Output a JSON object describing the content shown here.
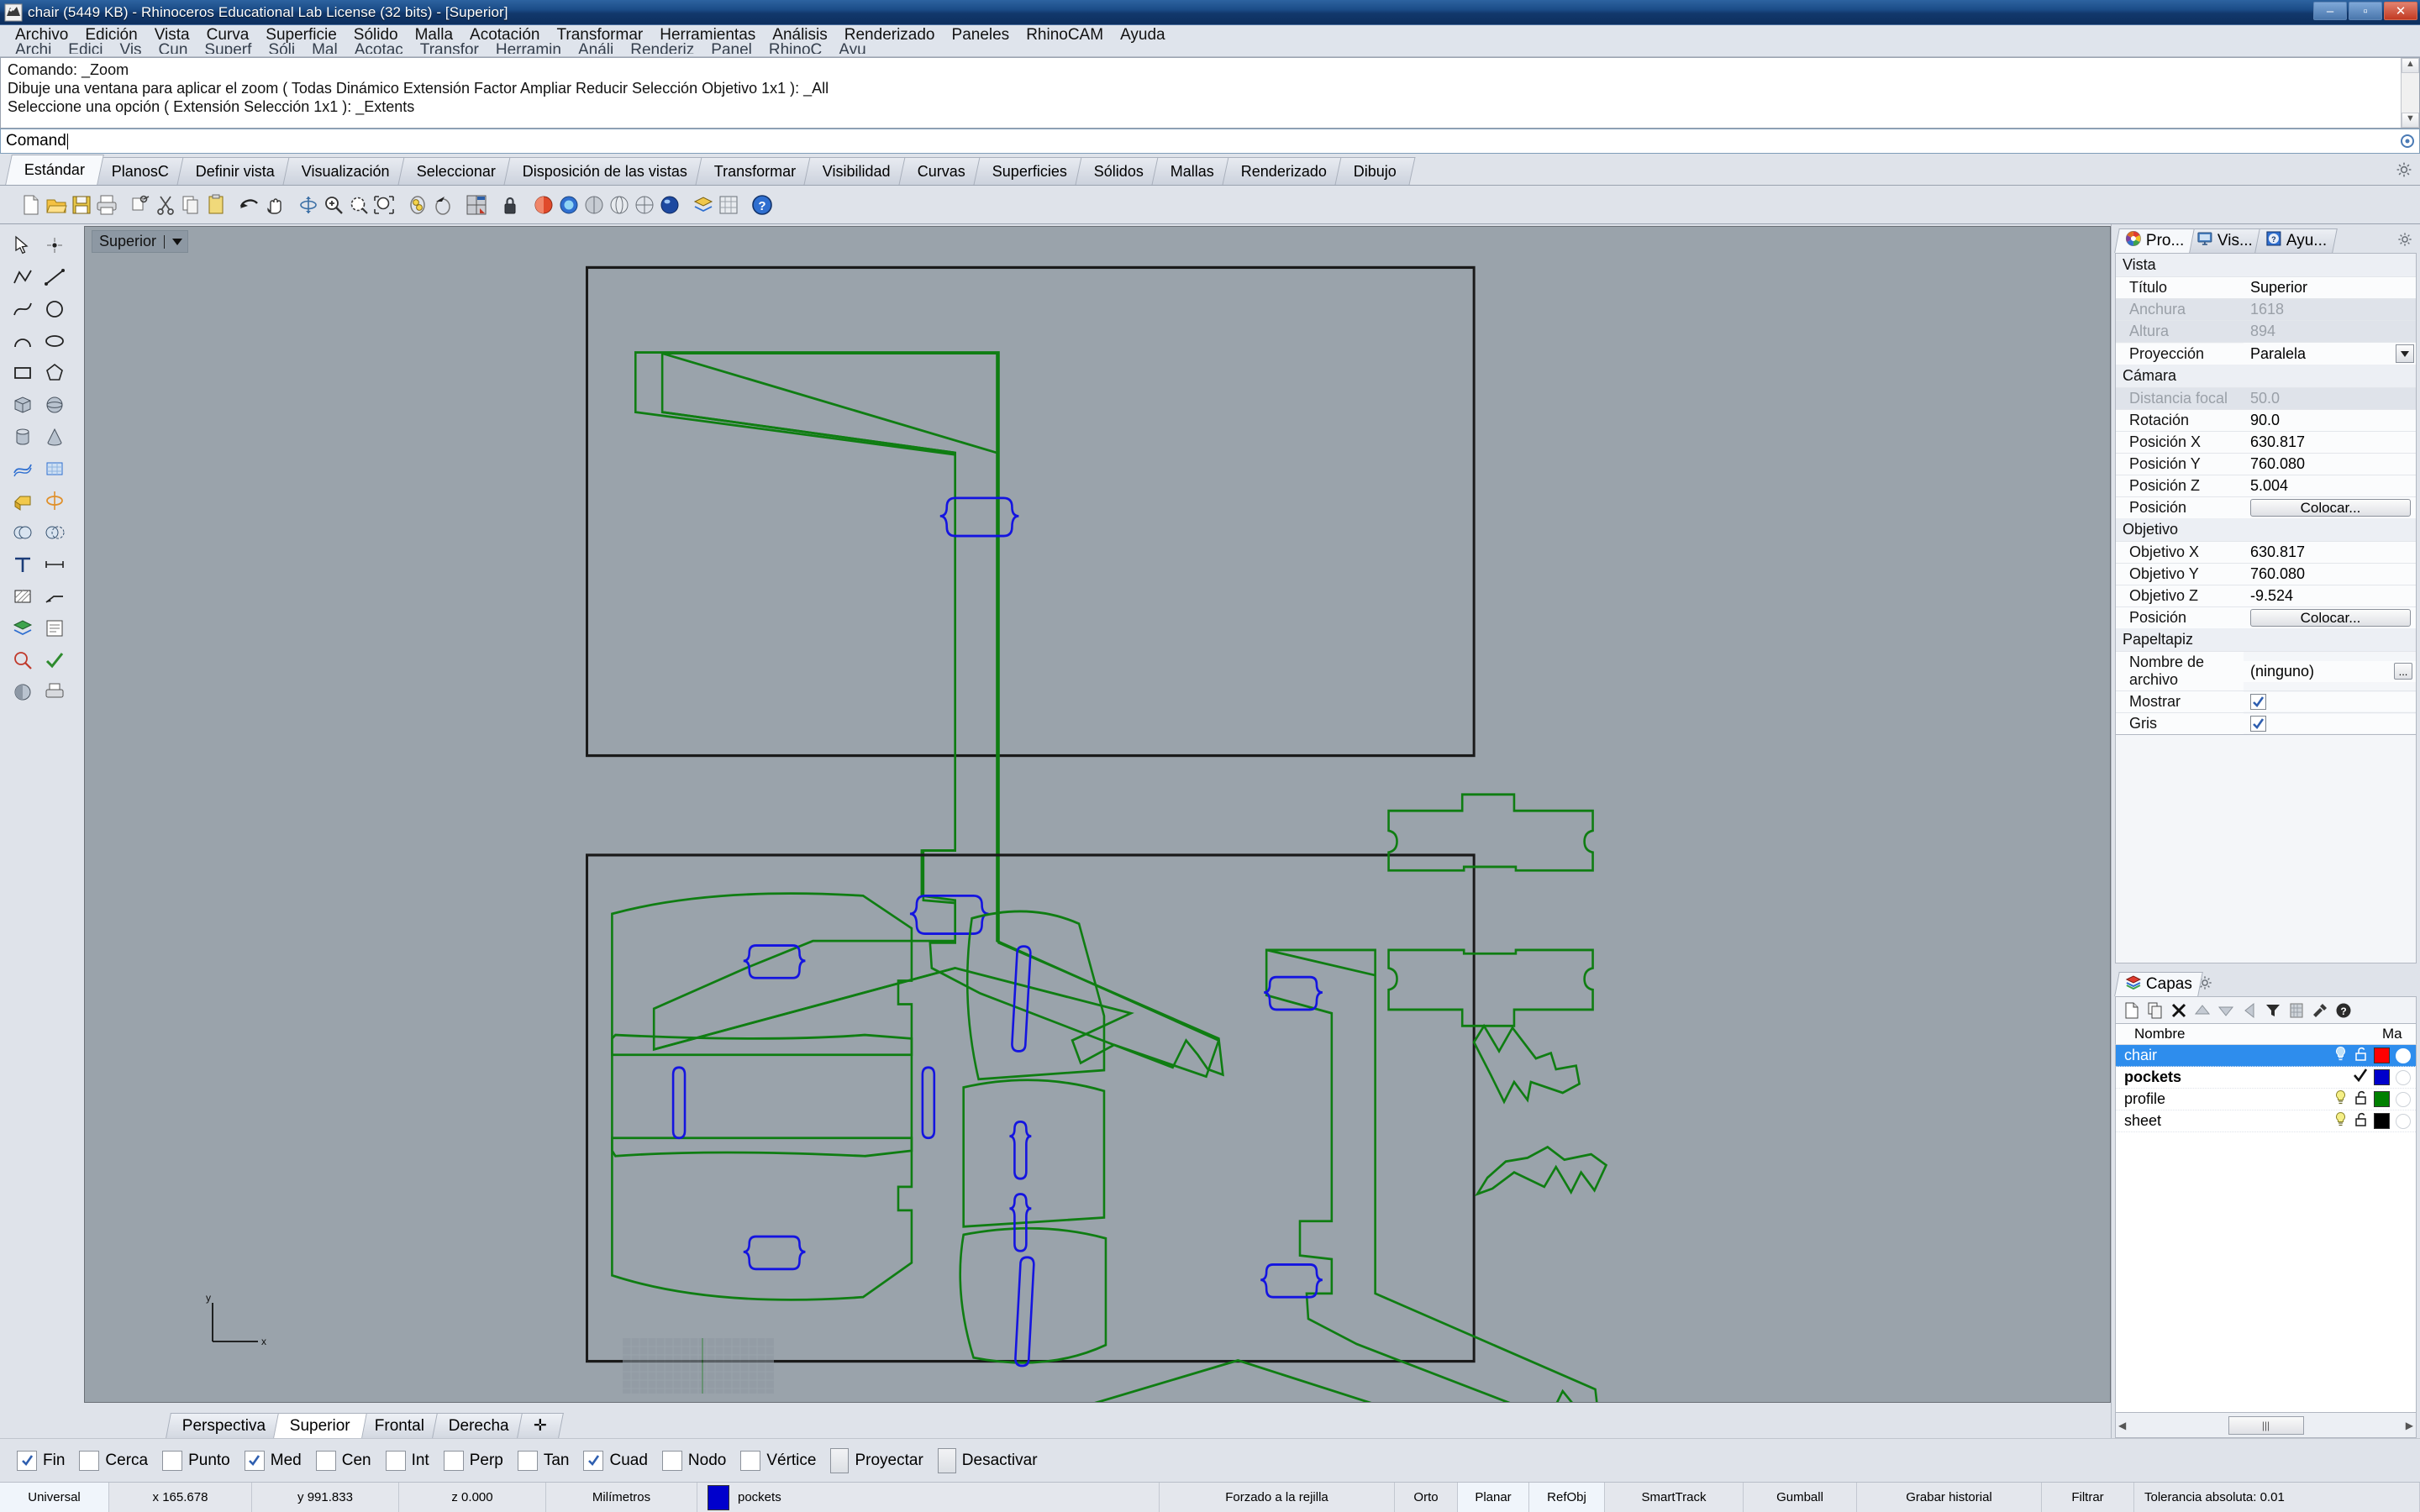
{
  "window": {
    "title": "chair (5449 KB) - Rhinoceros Educational Lab License (32 bits) - [Superior]",
    "minimize": "–",
    "maximize": "▫",
    "close": "✕"
  },
  "menubar": {
    "items": [
      "Archivo",
      "Edición",
      "Vista",
      "Curva",
      "Superficie",
      "Sólido",
      "Malla",
      "Acotación",
      "Transformar",
      "Herramientas",
      "Análisis",
      "Renderizado",
      "Paneles",
      "RhinoCAM",
      "Ayuda"
    ],
    "ghost_items": [
      "Archi",
      "Edici",
      "Vis",
      "Cun",
      "Superf",
      "Sóli",
      "Mal",
      "Acotac",
      "Transfor",
      "Herramin",
      "Análi",
      "Renderiz",
      "Panel",
      "RhinoC",
      "Ayu"
    ]
  },
  "command": {
    "history": [
      "Comando: _Zoom",
      "Dibuje una ventana para aplicar el zoom ( Todas  Dinámico  Extensión  Factor  Ampliar  Reducir  Selección  Objetivo  1x1 ): _All",
      "Seleccione una opción ( Extensión  Selección  1x1 ): _Extents"
    ],
    "prompt": "Comand"
  },
  "toolbar_tabs": {
    "items": [
      "Estándar",
      "PlanosC",
      "Definir vista",
      "Visualización",
      "Seleccionar",
      "Disposición de las vistas",
      "Transformar",
      "Visibilidad",
      "Curvas",
      "Superficies",
      "Sólidos",
      "Mallas",
      "Renderizado",
      "Dibujo"
    ],
    "active": "Estándar"
  },
  "viewport": {
    "label": "Superior",
    "axis_x": "x",
    "axis_y": "y",
    "tabs": [
      "Perspectiva",
      "Superior",
      "Frontal",
      "Derecha"
    ],
    "active_tab": "Superior",
    "add_tab": "✛",
    "colors": {
      "background": "#9aa3ab",
      "profile_green": "#0f7d12",
      "pockets_blue": "#1414e0",
      "sheet_black": "#1a1a1a"
    }
  },
  "properties": {
    "tabs": [
      {
        "label": "Pro...",
        "icon": "color-wheel-icon",
        "active": true
      },
      {
        "label": "Vis...",
        "icon": "monitor-icon",
        "active": false
      },
      {
        "label": "Ayu...",
        "icon": "help-icon",
        "active": false
      }
    ],
    "sections": [
      {
        "title": "Vista",
        "rows": [
          {
            "key": "Título",
            "value": "Superior",
            "type": "text",
            "dim": false
          },
          {
            "key": "Anchura",
            "value": "1618",
            "type": "text",
            "dim": true
          },
          {
            "key": "Altura",
            "value": "894",
            "type": "text",
            "dim": true
          },
          {
            "key": "Proyección",
            "value": "Paralela",
            "type": "select",
            "dim": false
          }
        ]
      },
      {
        "title": "Cámara",
        "rows": [
          {
            "key": "Distancia focal",
            "value": "50.0",
            "type": "text",
            "dim": true
          },
          {
            "key": "Rotación",
            "value": "90.0",
            "type": "text",
            "dim": false
          },
          {
            "key": "Posición X",
            "value": "630.817",
            "type": "text",
            "dim": false
          },
          {
            "key": "Posición Y",
            "value": "760.080",
            "type": "text",
            "dim": false
          },
          {
            "key": "Posición Z",
            "value": "5.004",
            "type": "text",
            "dim": false
          },
          {
            "key": "Posición",
            "value": "Colocar...",
            "type": "button",
            "dim": false
          }
        ]
      },
      {
        "title": "Objetivo",
        "rows": [
          {
            "key": "Objetivo X",
            "value": "630.817",
            "type": "text",
            "dim": false
          },
          {
            "key": "Objetivo Y",
            "value": "760.080",
            "type": "text",
            "dim": false
          },
          {
            "key": "Objetivo Z",
            "value": "-9.524",
            "type": "text",
            "dim": false
          },
          {
            "key": "Posición",
            "value": "Colocar...",
            "type": "button",
            "dim": false
          }
        ]
      },
      {
        "title": "Papeltapiz",
        "rows": [
          {
            "key": "Nombre de archivo",
            "value": "(ninguno)",
            "type": "file",
            "dim": false
          },
          {
            "key": "Mostrar",
            "value": "",
            "type": "checkbox",
            "checked": true,
            "dim": false
          },
          {
            "key": "Gris",
            "value": "",
            "type": "checkbox",
            "checked": true,
            "dim": false
          }
        ]
      }
    ]
  },
  "layers": {
    "panel_title": "Capas",
    "column_name": "Nombre",
    "column_material": "Ma",
    "toolbar_icons": [
      "new-layer-icon",
      "copy-layer-icon",
      "delete-layer-icon",
      "move-up-icon",
      "move-down-icon",
      "move-left-icon",
      "filter-icon",
      "sheet-icon",
      "tools-icon",
      "help-icon"
    ],
    "rows": [
      {
        "name": "chair",
        "selected": true,
        "current": false,
        "visible": true,
        "locked": false,
        "color": "#ff0000",
        "bold": false
      },
      {
        "name": "pockets",
        "selected": false,
        "current": true,
        "visible": true,
        "locked": false,
        "color": "#0000cc",
        "bold": true
      },
      {
        "name": "profile",
        "selected": false,
        "current": false,
        "visible": true,
        "locked": false,
        "color": "#008000",
        "bold": false
      },
      {
        "name": "sheet",
        "selected": false,
        "current": false,
        "visible": true,
        "locked": false,
        "color": "#000000",
        "bold": false
      }
    ]
  },
  "osnap": {
    "items": [
      {
        "label": "Fin",
        "checked": true,
        "style": "check"
      },
      {
        "label": "Cerca",
        "checked": false,
        "style": "check"
      },
      {
        "label": "Punto",
        "checked": false,
        "style": "check"
      },
      {
        "label": "Med",
        "checked": true,
        "style": "check"
      },
      {
        "label": "Cen",
        "checked": false,
        "style": "check"
      },
      {
        "label": "Int",
        "checked": false,
        "style": "check"
      },
      {
        "label": "Perp",
        "checked": false,
        "style": "check"
      },
      {
        "label": "Tan",
        "checked": false,
        "style": "check"
      },
      {
        "label": "Cuad",
        "checked": true,
        "style": "check"
      },
      {
        "label": "Nodo",
        "checked": false,
        "style": "check"
      },
      {
        "label": "Vértice",
        "checked": false,
        "style": "check"
      },
      {
        "label": "Proyectar",
        "checked": false,
        "style": "button"
      },
      {
        "label": "Desactivar",
        "checked": false,
        "style": "button"
      }
    ]
  },
  "statusbar": {
    "cplane": "Universal",
    "x": "x 165.678",
    "y": "y 991.833",
    "z": "z 0.000",
    "units": "Milímetros",
    "layer": "pockets",
    "layer_color": "#0000cc",
    "snap": "Forzado a la rejilla",
    "ortho": "Orto",
    "planar": "Planar",
    "osnap": "RefObj",
    "smarttrack": "SmartTrack",
    "gumball": "Gumball",
    "history": "Grabar historial",
    "filter": "Filtrar",
    "tolerance": "Tolerancia absoluta: 0.01"
  }
}
